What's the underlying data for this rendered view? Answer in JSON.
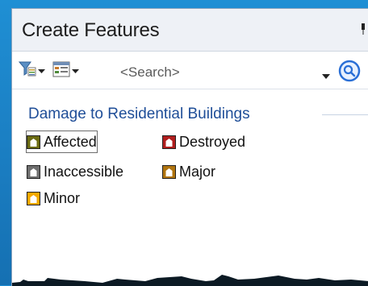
{
  "window": {
    "title": "Create Features",
    "pin_icon": "pin-icon"
  },
  "toolbar": {
    "filter_icon": "filter-icon",
    "view_icon": "organize-templates-icon",
    "search": {
      "value": "",
      "placeholder": "<Search>",
      "dropdown_icon": "chevron-down-icon",
      "go_icon": "search-icon"
    }
  },
  "templates": {
    "group_title": "Damage to Residential Buildings",
    "items": [
      {
        "label": "Affected",
        "color": "#6b6b12",
        "selected": true
      },
      {
        "label": "Destroyed",
        "color": "#b01e1e",
        "selected": false
      },
      {
        "label": "Inaccessible",
        "color": "#6e6e6e",
        "selected": false
      },
      {
        "label": "Major",
        "color": "#b0740f",
        "selected": false
      },
      {
        "label": "Minor",
        "color": "#f5a800",
        "selected": false
      }
    ]
  },
  "colors": {
    "desktop": "#1a7cc0",
    "group_header": "#1f4e98",
    "search_accent": "#2a6fd6"
  }
}
